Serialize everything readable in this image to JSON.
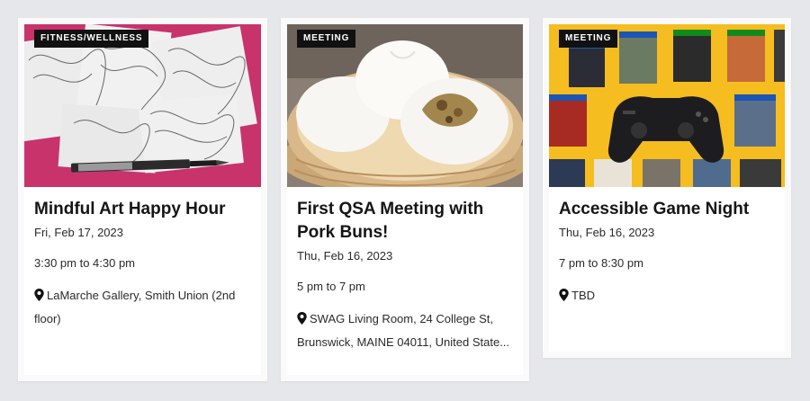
{
  "cards": [
    {
      "category": "FITNESS/WELLNESS",
      "title": "Mindful Art Happy Hour",
      "date": "Fri, Feb 17, 2023",
      "time": "3:30 pm to 4:30 pm",
      "location_line1": "LaMarche Gallery, Smith Union (2nd",
      "location_line2": "floor)",
      "image_desc": "art-drawings-with-pen"
    },
    {
      "category": "MEETING",
      "title_line1": "First QSA Meeting with",
      "title_line2": "Pork Buns!",
      "date": "Thu, Feb 16, 2023",
      "time": "5 pm to 7 pm",
      "location_line1": "SWAG Living Room, 24 College St,",
      "location_line2": "Brunswick, MAINE 04011, United State...",
      "image_desc": "pork-buns-steamer"
    },
    {
      "category": "MEETING",
      "title": "Accessible Game Night",
      "date": "Thu, Feb 16, 2023",
      "time": "7 pm to 8:30 pm",
      "location_line1": "TBD",
      "image_desc": "video-games-and-controller"
    }
  ],
  "colors": {
    "background": "#e6e7ea",
    "badge": "#111111",
    "card": "#ffffff",
    "art_bg": "#c8336c",
    "game_bg": "#f5bd1f"
  }
}
